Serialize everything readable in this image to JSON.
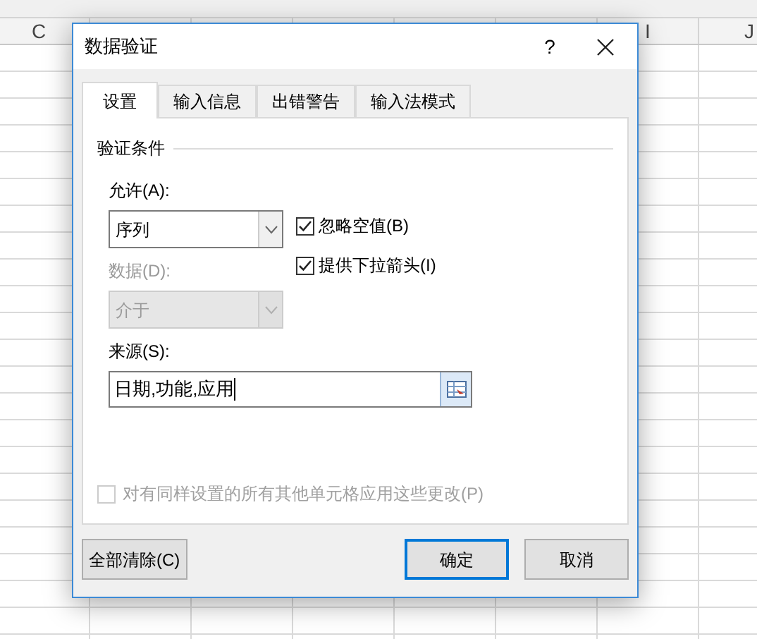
{
  "sheet": {
    "column_headers": [
      "C",
      "I",
      "J"
    ]
  },
  "dialog": {
    "title": "数据验证",
    "help": "?",
    "tabs": [
      {
        "label": "设置",
        "selected": true
      },
      {
        "label": "输入信息",
        "selected": false
      },
      {
        "label": "出错警告",
        "selected": false
      },
      {
        "label": "输入法模式",
        "selected": false
      }
    ],
    "group_title": "验证条件",
    "allow": {
      "label": "允许(A):",
      "value": "序列",
      "disabled": false
    },
    "data": {
      "label": "数据(D):",
      "value": "介于",
      "disabled": true
    },
    "options": [
      {
        "label": "忽略空值(B)",
        "checked": true
      },
      {
        "label": "提供下拉箭头(I)",
        "checked": true
      }
    ],
    "source": {
      "label": "来源(S):",
      "value": "日期,功能,应用"
    },
    "apply_all": {
      "label": "对有同样设置的所有其他单元格应用这些更改(P)",
      "checked": false,
      "disabled": true
    },
    "buttons": [
      {
        "label": "全部清除(C)",
        "kind": "left",
        "default": false
      },
      {
        "label": "确定",
        "kind": "right",
        "default": true
      },
      {
        "label": "取消",
        "kind": "right",
        "default": false
      }
    ]
  }
}
